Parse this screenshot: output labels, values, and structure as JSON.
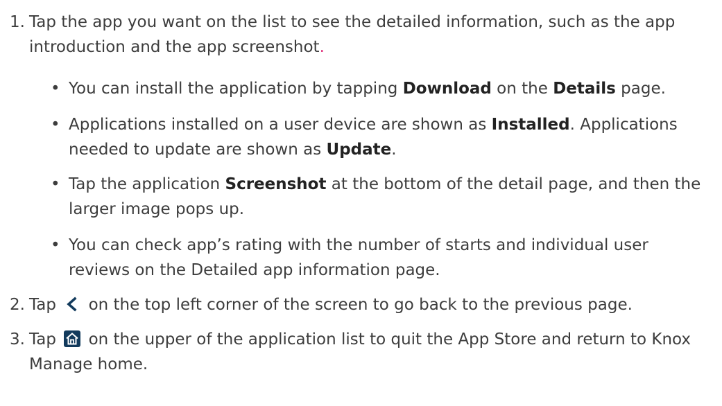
{
  "steps": [
    {
      "number": "1.",
      "text": "Tap the app you want on the list to see the detailed information, such as the app introduction and the app screenshot",
      "end": "."
    },
    {
      "number": "2.",
      "before": "Tap",
      "icon": "back-chevron-icon",
      "after": "on the top left corner of the screen to go back to the previous page."
    },
    {
      "number": "3.",
      "before": "Tap",
      "icon": "home-icon",
      "after": "on the upper of the application list to quit the App Store and return to Knox Manage home."
    }
  ],
  "bullets": [
    {
      "a": "You can install the application by tapping ",
      "b1": "Download",
      "c": " on the ",
      "b2": "Details",
      "d": " page."
    },
    {
      "a": "Applications installed on a user device are shown as ",
      "b1": "Installed",
      "c": ". Applications needed to update are shown as ",
      "b2": "Update",
      "d": "."
    },
    {
      "a": "Tap the application ",
      "b1": "Screenshot",
      "c": " at the bottom of the detail page, and then the larger image pops up."
    },
    {
      "a": "You can check app’s rating with the number of starts and individual user reviews on the Detailed app information page."
    }
  ],
  "bullet_symbol": "•",
  "colors": {
    "text": "#3d3d3d",
    "accent": "#e0307a",
    "icon_bg": "#ffffff"
  }
}
